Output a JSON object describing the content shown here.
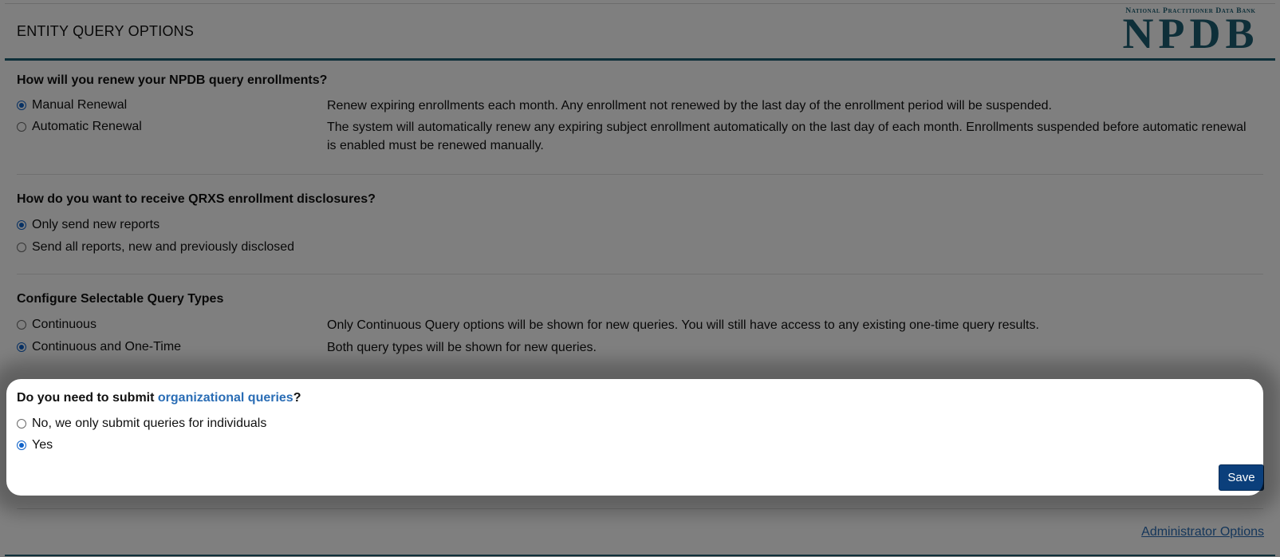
{
  "header": {
    "title": "ENTITY QUERY OPTIONS",
    "logo_small": "National Practitioner Data Bank",
    "logo_big": "NPDB"
  },
  "renewal": {
    "question": "How will you renew your NPDB query enrollments?",
    "options": [
      {
        "label": "Manual Renewal",
        "selected": true,
        "description": "Renew expiring enrollments each month. Any enrollment not renewed by the last day of the enrollment period will be suspended."
      },
      {
        "label": "Automatic Renewal",
        "selected": false,
        "description": "The system will automatically renew any expiring subject enrollment automatically on the last day of each month. Enrollments suspended before automatic renewal is enabled must be renewed manually."
      }
    ]
  },
  "disclosures": {
    "question": "How do you want to receive QRXS enrollment disclosures?",
    "options": [
      {
        "label": "Only send new reports",
        "selected": true
      },
      {
        "label": "Send all reports, new and previously disclosed",
        "selected": false
      }
    ]
  },
  "query_types": {
    "question": "Configure Selectable Query Types",
    "options": [
      {
        "label": "Continuous",
        "selected": false,
        "description": "Only Continuous Query options will be shown for new queries. You will still have access to any existing one-time query results."
      },
      {
        "label": "Continuous and One-Time",
        "selected": true,
        "description": "Both query types will be shown for new queries."
      }
    ]
  },
  "org_queries": {
    "question_prefix": "Do you need to submit ",
    "question_link": "organizational queries",
    "question_suffix": "?",
    "options": [
      {
        "label": "No, we only submit queries for individuals",
        "selected": false
      },
      {
        "label": "Yes",
        "selected": true
      }
    ]
  },
  "actions": {
    "save_label": "Save",
    "admin_link": "Administrator Options"
  },
  "colors": {
    "accent": "#1d5f73",
    "button": "#0b3f7b",
    "link": "#2a6db5",
    "radio_selected": "#0f62c9"
  }
}
